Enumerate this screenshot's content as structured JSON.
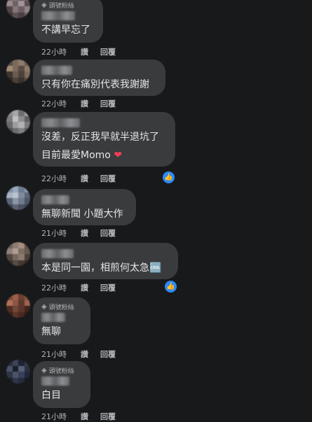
{
  "comments": [
    {
      "badge": "頭號粉絲",
      "text": "不講早忘了",
      "time": "22小時",
      "like": "讚",
      "reply": "回覆"
    },
    {
      "text": "只有你在痛別代表我謝謝",
      "time": "22小時",
      "like": "讚",
      "reply": "回覆"
    },
    {
      "line1": "沒差，反正我早就半退坑了",
      "line2": "目前最愛Momo",
      "time": "22小時",
      "like": "讚",
      "reply": "回覆"
    },
    {
      "text": "無聊新聞 小題大作",
      "time": "21小時",
      "like": "讚",
      "reply": "回覆"
    },
    {
      "text": "本是同一園，相煎何太急🆒",
      "time": "22小時",
      "like": "讚",
      "reply": "回覆"
    },
    {
      "badge": "頭號粉絲",
      "text": "無聊",
      "time": "21小時",
      "like": "讚",
      "reply": "回覆"
    },
    {
      "badge": "頭號粉絲",
      "text": "白目",
      "time": "21小時",
      "like": "讚",
      "reply": "回覆"
    }
  ],
  "icons": {
    "fan_badge": "diamond-icon",
    "like_reaction": "thumbs-up-icon",
    "heart": "heart-icon"
  },
  "colors": {
    "background": "#18191a",
    "bubble": "#3a3b3c",
    "like_blue": "#2d88ff",
    "heart_red": "#f33e58"
  }
}
